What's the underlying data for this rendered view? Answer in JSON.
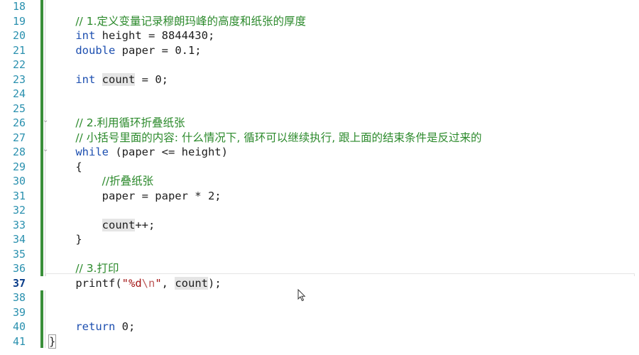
{
  "editor": {
    "active_line": "37",
    "lines": [
      {
        "n": "18",
        "segs": []
      },
      {
        "n": "19",
        "segs": [
          {
            "t": "    "
          },
          {
            "t": "// 1.定义变量记录穆朗玛峰的高度和纸张的厚度",
            "c": "cm"
          }
        ]
      },
      {
        "n": "20",
        "segs": [
          {
            "t": "    "
          },
          {
            "t": "int",
            "c": "kw"
          },
          {
            "t": " height = 8844430;"
          }
        ]
      },
      {
        "n": "21",
        "segs": [
          {
            "t": "    "
          },
          {
            "t": "double",
            "c": "kw"
          },
          {
            "t": " paper = 0.1;"
          }
        ]
      },
      {
        "n": "22",
        "segs": []
      },
      {
        "n": "23",
        "segs": [
          {
            "t": "    "
          },
          {
            "t": "int",
            "c": "kw"
          },
          {
            "t": " "
          },
          {
            "t": "count",
            "c": "hl"
          },
          {
            "t": " = 0;"
          }
        ]
      },
      {
        "n": "24",
        "segs": []
      },
      {
        "n": "25",
        "segs": []
      },
      {
        "n": "26",
        "segs": [
          {
            "t": "    "
          },
          {
            "t": "// 2.利用循环折叠纸张",
            "c": "cm"
          }
        ]
      },
      {
        "n": "27",
        "segs": [
          {
            "t": "    "
          },
          {
            "t": "// 小括号里面的内容: 什么情况下, 循环可以继续执行, 跟上面的结束条件是反过来的",
            "c": "cm"
          }
        ]
      },
      {
        "n": "28",
        "segs": [
          {
            "t": "    "
          },
          {
            "t": "while",
            "c": "kw"
          },
          {
            "t": " (paper <= height)"
          }
        ]
      },
      {
        "n": "29",
        "segs": [
          {
            "t": "    {"
          }
        ]
      },
      {
        "n": "30",
        "segs": [
          {
            "t": "        "
          },
          {
            "t": "//折叠纸张",
            "c": "cm"
          }
        ]
      },
      {
        "n": "31",
        "segs": [
          {
            "t": "        paper = paper * 2;"
          }
        ]
      },
      {
        "n": "32",
        "segs": []
      },
      {
        "n": "33",
        "segs": [
          {
            "t": "        "
          },
          {
            "t": "count",
            "c": "hl"
          },
          {
            "t": "++;"
          }
        ]
      },
      {
        "n": "34",
        "segs": [
          {
            "t": "    }"
          }
        ]
      },
      {
        "n": "35",
        "segs": []
      },
      {
        "n": "36",
        "segs": [
          {
            "t": "    "
          },
          {
            "t": "// 3.打印",
            "c": "cm"
          }
        ]
      },
      {
        "n": "37",
        "segs": [
          {
            "t": "    printf("
          },
          {
            "t": "\"%d",
            "c": "str"
          },
          {
            "t": "\\n",
            "c": "esc"
          },
          {
            "t": "\"",
            "c": "str"
          },
          {
            "t": ", "
          },
          {
            "t": "count",
            "c": "hl"
          },
          {
            "t": ");"
          }
        ]
      },
      {
        "n": "38",
        "segs": []
      },
      {
        "n": "39",
        "segs": []
      },
      {
        "n": "40",
        "segs": [
          {
            "t": "    "
          },
          {
            "t": "return",
            "c": "kw"
          },
          {
            "t": " 0;"
          }
        ]
      },
      {
        "n": "41",
        "segs": [
          {
            "t": "}",
            "c": "brace-box"
          }
        ]
      }
    ],
    "fold_markers": [
      "26",
      "28"
    ]
  }
}
